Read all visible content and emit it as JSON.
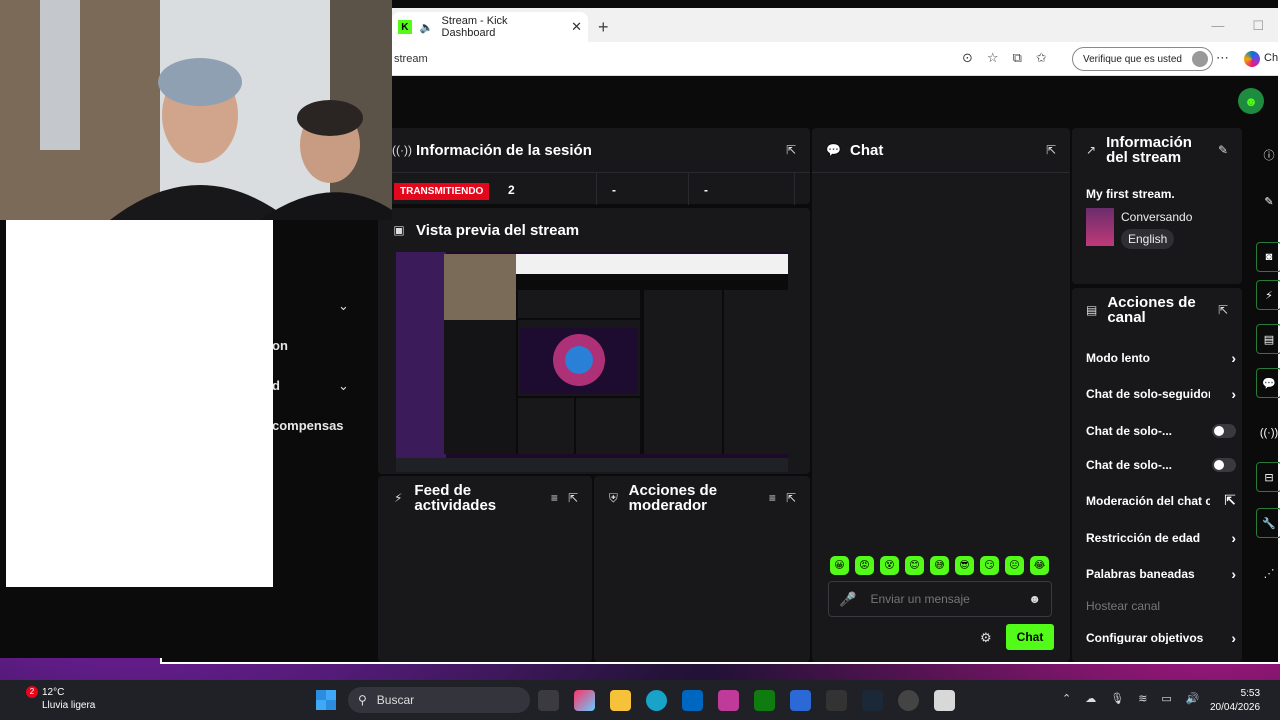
{
  "browser": {
    "tab_title": "Stream - Kick Dashboard",
    "url": "stream",
    "verify_label": "Verifique que es usted",
    "addr_edge_text": "Ch"
  },
  "left_menu": {
    "items": [
      "on",
      "d",
      "compensas"
    ]
  },
  "session": {
    "title": "Información de la sesión",
    "live_badge": "TRANSMITIENDO",
    "viewers": "2",
    "stat2": "-",
    "stat3": "-"
  },
  "preview": {
    "title": "Vista previa del stream"
  },
  "feed": {
    "title": "Feed de actividades"
  },
  "mod_actions": {
    "title": "Acciones de moderador"
  },
  "chat": {
    "title": "Chat",
    "placeholder": "Enviar un mensaje",
    "send_label": "Chat",
    "emotes": [
      "😀",
      "😡",
      "😵",
      "😊",
      "😅",
      "😎",
      "😏",
      "😐",
      "😂"
    ]
  },
  "stream_info": {
    "title": "Información del stream",
    "stream_title": "My first stream.",
    "category": "Conversando",
    "language": "English"
  },
  "channel_actions": {
    "title": "Acciones de canal",
    "items": [
      {
        "label": "Modo lento",
        "control": "arrow"
      },
      {
        "label": "Chat de solo-seguidores",
        "control": "arrow"
      },
      {
        "label": "Chat de solo-...",
        "control": "toggle"
      },
      {
        "label": "Chat de solo-...",
        "control": "toggle"
      },
      {
        "label": "Moderación del chat con IA",
        "control": "external"
      },
      {
        "label": "Restricción de edad",
        "control": "arrow"
      },
      {
        "label": "Palabras baneadas",
        "control": "arrow"
      },
      {
        "label": "Hostear canal",
        "control": "disabled"
      },
      {
        "label": "Configurar objetivos",
        "control": "arrow"
      }
    ]
  },
  "taskbar": {
    "temperature": "12°C",
    "weather": "Lluvia ligera",
    "notif_count": "2",
    "search_label": "Buscar",
    "time": "5:53",
    "date": "20/04/2026"
  },
  "colors": {
    "kick_green": "#53fc18",
    "live_red": "#e3071c",
    "panel_bg": "#18181b",
    "page_bg": "#0b0b0c"
  }
}
